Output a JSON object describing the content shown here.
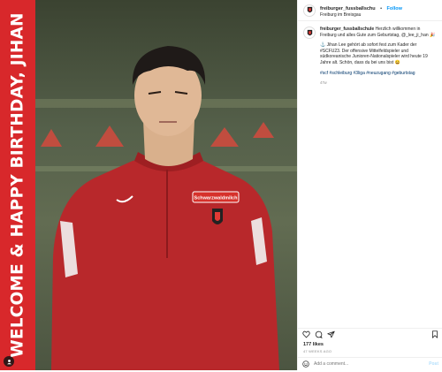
{
  "banner": {
    "text": "WELCOME & HAPPY BIRTHDAY, JIHAN"
  },
  "photo": {
    "shirt_sponsor": "Schwarzwaldmilch"
  },
  "header": {
    "username": "freiburger_fussballschu",
    "separator": "•",
    "follow_label": "Follow",
    "location": "Freiburg im Breisgau"
  },
  "caption": {
    "username": "freiburger_fussballschule",
    "line1": " Herzlich willkommen in Freiburg und alles Gute zum Geburtstag, @_lee_ji_han 🎉",
    "para2": "⚓ Jihan Lee gehört ab sofort fest zum Kader der #SCFU23. Der offensive Mittelfeldspieler und südkoreanische Junioren-Nationalspieler wird heute 19 Jahre alt. Schön, dass du bei uns bist 😀",
    "hashtags": "#scf #schleiburg #3liga #neuzugang #geburtstag",
    "time": "47w"
  },
  "stats": {
    "likes": "177 likes",
    "time_ago": "47 WEEKS AGO"
  },
  "comment": {
    "placeholder": "Add a comment...",
    "post_label": "Post"
  },
  "icons": [
    "heart-icon",
    "comment-icon",
    "share-icon",
    "bookmark-icon",
    "emoji-icon"
  ],
  "colors": {
    "banner_red": "#d8282b",
    "link_blue": "#0095f6",
    "hashtag_blue": "#00376b"
  }
}
